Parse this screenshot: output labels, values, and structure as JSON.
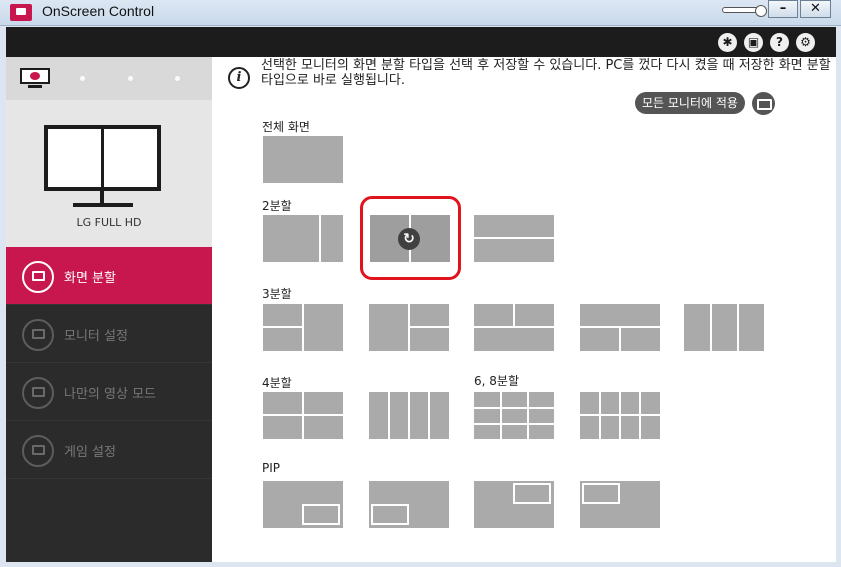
{
  "window": {
    "title": "OnScreen Control",
    "min_label": "–",
    "close_label": "✕"
  },
  "topbar": {
    "icons": [
      "cursor-icon",
      "display-icon",
      "help-icon",
      "settings-icon"
    ],
    "help_label": "?"
  },
  "sidebar": {
    "monitor_name": "LG FULL HD",
    "menu": [
      {
        "label": "화면 분할",
        "active": true
      },
      {
        "label": "모니터 설정",
        "active": false
      },
      {
        "label": "나만의 영상 모드",
        "active": false
      },
      {
        "label": "게임 설정",
        "active": false
      }
    ]
  },
  "main": {
    "info_text": "선택한 모니터의 화면 분할 타입을 선택 후 저장할 수 있습니다. PC를 껐다 다시 켰을 때 저장한 화면 분할 타입으로 바로 실행됩니다.",
    "info_icon_label": "i",
    "apply_all_label": "모든 모니터에 적용",
    "sections": {
      "full": "전체 화면",
      "split2": "2분할",
      "split3": "3분할",
      "split4": "4분할",
      "split68": "6, 8분할",
      "pip": "PIP"
    },
    "selected_layout": "2분할 세로 1:1",
    "rotate_label": "↻"
  },
  "colors": {
    "accent": "#c8174f",
    "selection_ring": "#e0141c",
    "layout_tile": "#aaaaaa"
  }
}
